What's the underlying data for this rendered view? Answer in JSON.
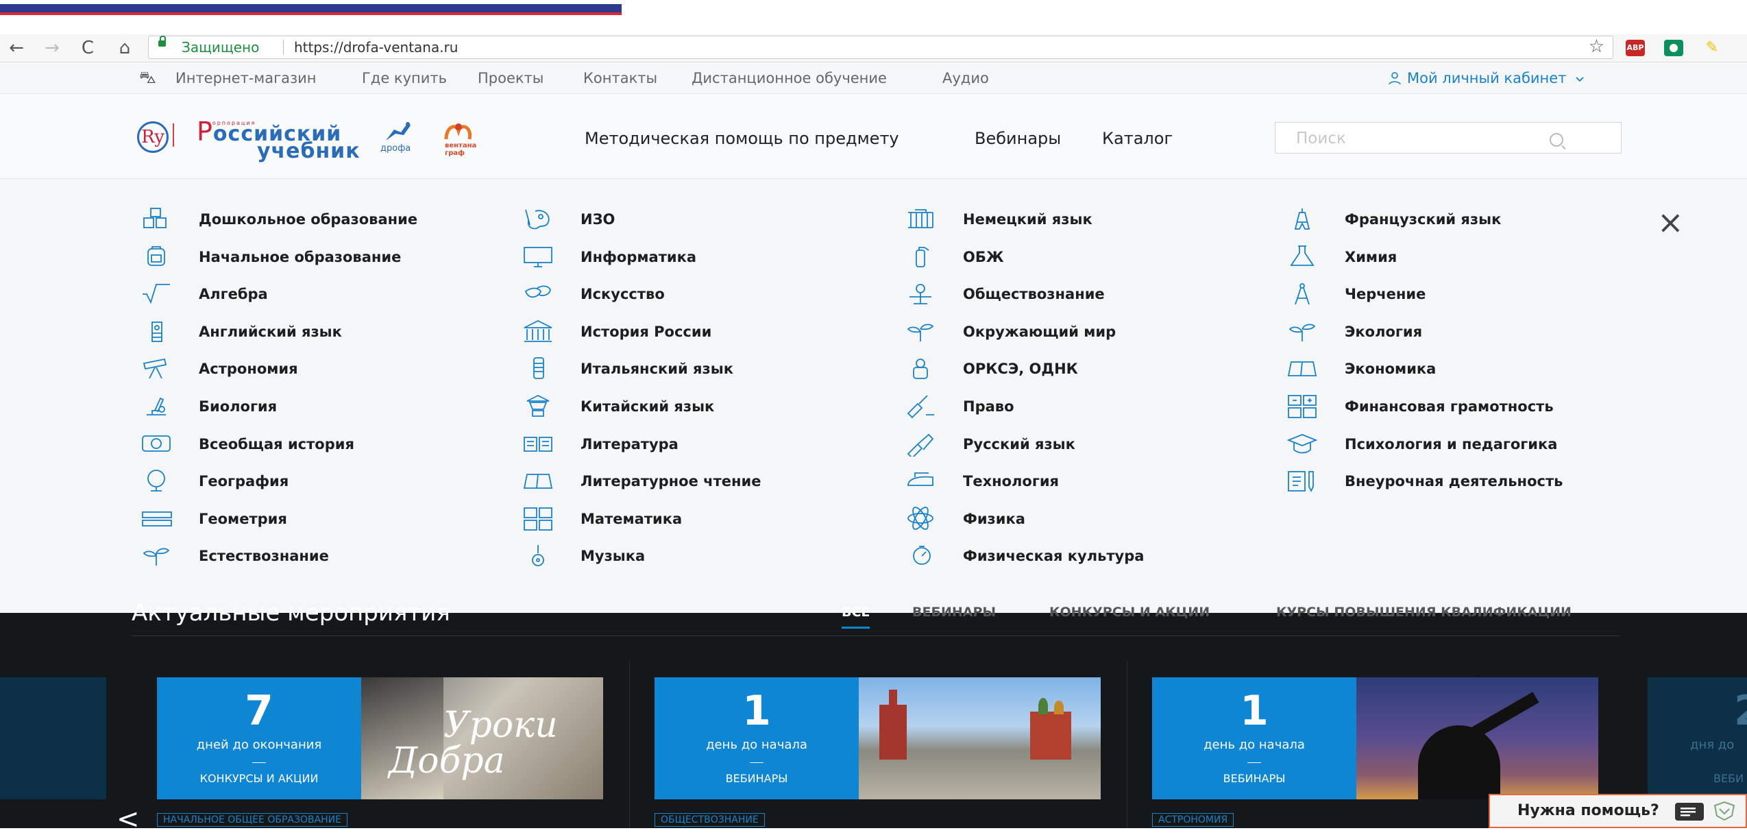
{
  "browser": {
    "back": "←",
    "forward": "→",
    "reload": "C",
    "home": "⌂",
    "secure_label": "Защищено",
    "url": "https://drofa-ventana.ru",
    "star": "☆",
    "extensions": [
      "ABP",
      "eye",
      "lamp"
    ]
  },
  "topnav": {
    "items": [
      "Интернет-магазин",
      "Где купить",
      "Проекты",
      "Контакты",
      "Дистанционное обучение",
      "Аудио"
    ],
    "cabinet": "Мой личный кабинет"
  },
  "header": {
    "logo_small": "корпорация",
    "logo_line1": "оссийский",
    "logo_line1_letter": "Р",
    "logo_line2": "учебник",
    "drofa": "дрофа",
    "ventana": "вентана граф",
    "nav": [
      "Методическая помощь по предмету",
      "Вебинары",
      "Каталог"
    ],
    "search_placeholder": "Поиск"
  },
  "menu": {
    "close": "×",
    "columns": [
      [
        {
          "label": "Дошкольное образование",
          "icon": "blocks-icon"
        },
        {
          "label": "Начальное образование",
          "icon": "backpack-icon"
        },
        {
          "label": "Алгебра",
          "icon": "sqrt-icon"
        },
        {
          "label": "Английский язык",
          "icon": "big-ben-icon"
        },
        {
          "label": "Астрономия",
          "icon": "telescope-icon"
        },
        {
          "label": "Биология",
          "icon": "microscope-icon"
        },
        {
          "label": "Всеобщая история",
          "icon": "scroll-map-icon"
        },
        {
          "label": "География",
          "icon": "globe-icon"
        },
        {
          "label": "Геометрия",
          "icon": "ruler-icon"
        },
        {
          "label": "Естествознание",
          "icon": "sprout-icon"
        }
      ],
      [
        {
          "label": "ИЗО",
          "icon": "palette-icon"
        },
        {
          "label": "Информатика",
          "icon": "monitor-icon"
        },
        {
          "label": "Искусство",
          "icon": "masks-icon"
        },
        {
          "label": "История России",
          "icon": "museum-icon"
        },
        {
          "label": "Итальянский язык",
          "icon": "pisa-tower-icon"
        },
        {
          "label": "Китайский язык",
          "icon": "pagoda-icon"
        },
        {
          "label": "Литература",
          "icon": "open-book-icon"
        },
        {
          "label": "Литературное чтение",
          "icon": "book-icon"
        },
        {
          "label": "Математика",
          "icon": "calculator-icon"
        },
        {
          "label": "Музыка",
          "icon": "guitar-icon"
        }
      ],
      [
        {
          "label": "Немецкий язык",
          "icon": "brandenburg-gate-icon"
        },
        {
          "label": "ОБЖ",
          "icon": "extinguisher-icon"
        },
        {
          "label": "Обществознание",
          "icon": "people-icon"
        },
        {
          "label": "Окружающий мир",
          "icon": "leaf-icon"
        },
        {
          "label": "ОРКСЭ, ОДНК",
          "icon": "church-icon"
        },
        {
          "label": "Право",
          "icon": "gavel-icon"
        },
        {
          "label": "Русский язык",
          "icon": "pen-nib-icon"
        },
        {
          "label": "Технология",
          "icon": "iron-icon"
        },
        {
          "label": "Физика",
          "icon": "atom-icon"
        },
        {
          "label": "Физическая культура",
          "icon": "stopwatch-icon"
        }
      ],
      [
        {
          "label": "Французский язык",
          "icon": "eiffel-tower-icon"
        },
        {
          "label": "Химия",
          "icon": "flask-icon"
        },
        {
          "label": "Черчение",
          "icon": "compass-icon"
        },
        {
          "label": "Экология",
          "icon": "plant-icon"
        },
        {
          "label": "Экономика",
          "icon": "book-open-icon"
        },
        {
          "label": "Финансовая грамотность",
          "icon": "calculator-grid-icon"
        },
        {
          "label": "Психология и педагогика",
          "icon": "graduation-cap-icon"
        },
        {
          "label": "Внеурочная деятельность",
          "icon": "document-pen-icon"
        }
      ]
    ]
  },
  "events": {
    "title": "Актуальные мероприятия",
    "tabs": [
      "ВСЕ",
      "ВЕБИНАРЫ",
      "КОНКУРСЫ И АКЦИИ",
      "КУРСЫ ПОВЫШЕНИЯ КВАЛИФИКАЦИИ"
    ],
    "cards": [
      {
        "number": "7",
        "days": "дней до окончания",
        "dash": "—",
        "type": "КОНКУРСЫ И АКЦИИ",
        "tag": "НАЧАЛЬНОЕ ОБЩЕЕ ОБРАЗОВАНИЕ",
        "image_text_1": "Уроки",
        "image_text_2": "Добра"
      },
      {
        "number": "1",
        "days": "день до начала",
        "dash": "—",
        "type": "ВЕБИНАРЫ",
        "tag": "ОБЩЕСТВОЗНАНИЕ"
      },
      {
        "number": "1",
        "days": "день до начала",
        "dash": "—",
        "type": "ВЕБИНАРЫ",
        "tag": "АСТРОНОМИЯ"
      }
    ],
    "partial_card": {
      "number": "2",
      "days": "дня до",
      "type": "ВЕБИ"
    },
    "prev_arrow": "<"
  },
  "help": {
    "label": "Нужна помощь?"
  },
  "colors": {
    "accent": "#1a82c9",
    "card_blue": "#0f86d4",
    "dark_bg": "#15181b",
    "help_border": "#e5683c"
  }
}
